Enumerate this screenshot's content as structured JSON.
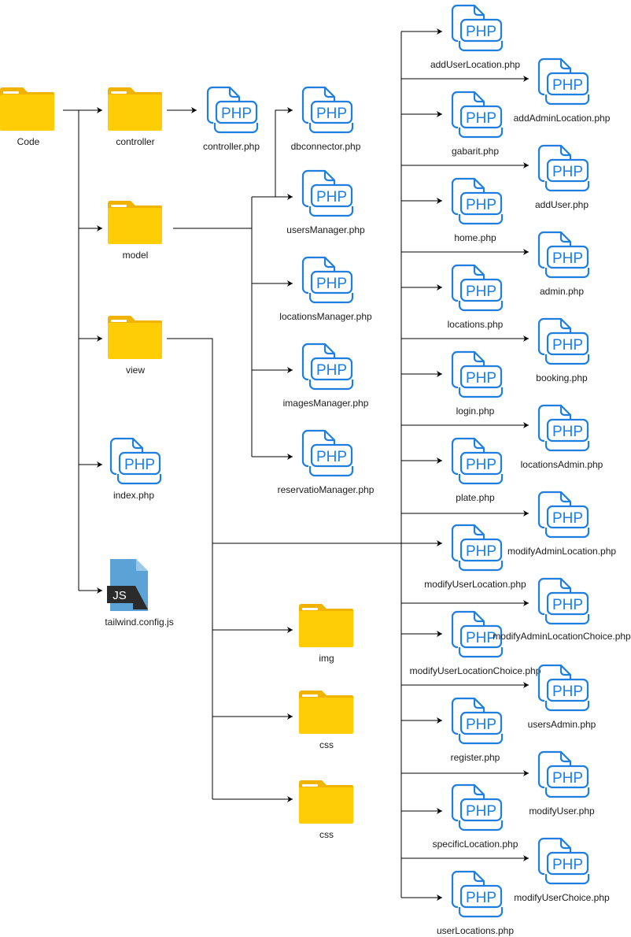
{
  "colors": {
    "folder_front": "#FFCD05",
    "folder_back": "#F0B400",
    "folder_tab_slot": "#ffffff",
    "php_stroke": "#1E7FE0",
    "js_body": "#5BA3D6",
    "js_fold": "#9CC8EA",
    "js_badge": "#2B2B2B",
    "js_text": "#ffffff",
    "edge": "#000000",
    "label": "#1a1a1a"
  },
  "icons": {
    "php_glyph": "PHP",
    "js_glyph": "JS"
  },
  "nodes": {
    "code": {
      "label": "Code",
      "icon": "folder-icon"
    },
    "controller": {
      "label": "controller",
      "icon": "folder-icon"
    },
    "model": {
      "label": "model",
      "icon": "folder-icon"
    },
    "view": {
      "label": "view",
      "icon": "folder-icon"
    },
    "index": {
      "label": "index.php",
      "icon": "php-file-icon"
    },
    "tailwind": {
      "label": "tailwind.config.js",
      "icon": "js-file-icon"
    },
    "controller_php": {
      "label": "controller.php",
      "icon": "php-file-icon"
    },
    "dbconnector": {
      "label": "dbconnector.php",
      "icon": "php-file-icon"
    },
    "usersManager": {
      "label": "usersManager.php",
      "icon": "php-file-icon"
    },
    "locationsManager": {
      "label": "locationsManager.php",
      "icon": "php-file-icon"
    },
    "imagesManager": {
      "label": "imagesManager.php",
      "icon": "php-file-icon"
    },
    "reservatioManager": {
      "label": "reservatioManager.php",
      "icon": "php-file-icon"
    },
    "img": {
      "label": "img",
      "icon": "folder-icon"
    },
    "css1": {
      "label": "css",
      "icon": "folder-icon"
    },
    "css2": {
      "label": "css",
      "icon": "folder-icon"
    },
    "addUserLocation": {
      "label": "addUserLocation.php",
      "icon": "php-file-icon"
    },
    "gabarit": {
      "label": "gabarit.php",
      "icon": "php-file-icon"
    },
    "home": {
      "label": "home.php",
      "icon": "php-file-icon"
    },
    "locations": {
      "label": "locations.php",
      "icon": "php-file-icon"
    },
    "login": {
      "label": "login.php",
      "icon": "php-file-icon"
    },
    "plate": {
      "label": "plate.php",
      "icon": "php-file-icon"
    },
    "modifyUserLocation": {
      "label": "modifyUserLocation.php",
      "icon": "php-file-icon"
    },
    "modifyUserLocationChoice": {
      "label": "modifyUserLocationChoice.php",
      "icon": "php-file-icon"
    },
    "register": {
      "label": "register.php",
      "icon": "php-file-icon"
    },
    "specificLocation": {
      "label": "specificLocation.php",
      "icon": "php-file-icon"
    },
    "userLocations": {
      "label": "userLocations.php",
      "icon": "php-file-icon"
    },
    "addAdminLocation": {
      "label": "addAdminLocation.php",
      "icon": "php-file-icon"
    },
    "addUser": {
      "label": "addUser.php",
      "icon": "php-file-icon"
    },
    "admin": {
      "label": "admin.php",
      "icon": "php-file-icon"
    },
    "booking": {
      "label": "booking.php",
      "icon": "php-file-icon"
    },
    "locationsAdmin": {
      "label": "locationsAdmin.php",
      "icon": "php-file-icon"
    },
    "modifyAdminLocation": {
      "label": "modifyAdminLocation.php",
      "icon": "php-file-icon"
    },
    "modifyAdminLocationChoice": {
      "label": "modifyAdminLocationChoice.php",
      "icon": "php-file-icon"
    },
    "usersAdmin": {
      "label": "usersAdmin.php",
      "icon": "php-file-icon"
    },
    "modifyUser": {
      "label": "modifyUser.php",
      "icon": "php-file-icon"
    },
    "modifyUserChoice": {
      "label": "modifyUserChoice.php",
      "icon": "php-file-icon"
    }
  }
}
